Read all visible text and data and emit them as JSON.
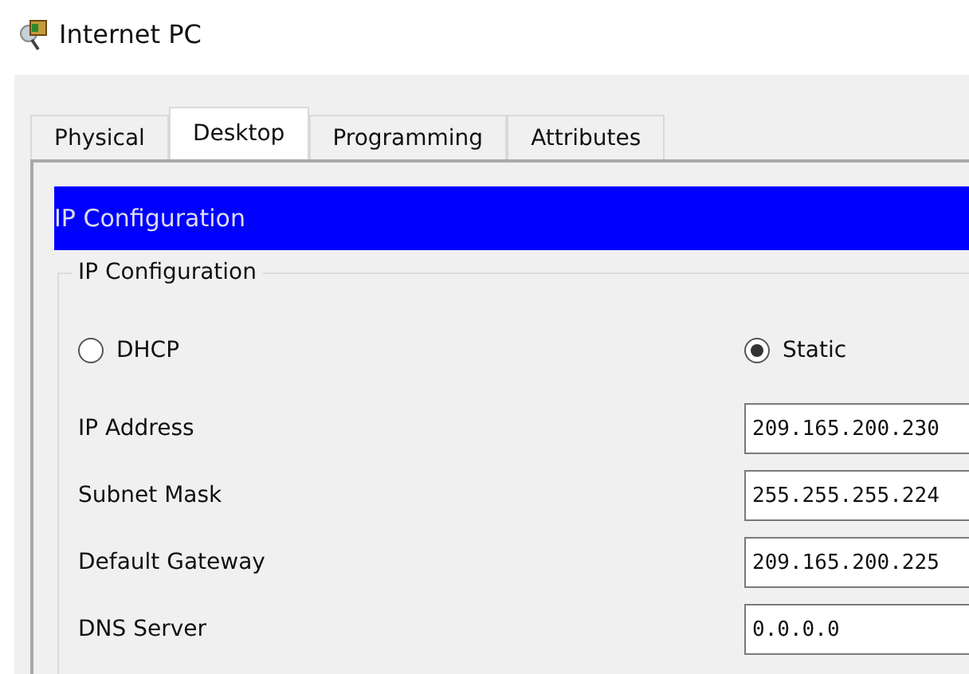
{
  "window": {
    "title": "Internet PC"
  },
  "tabs": [
    {
      "label": "Physical",
      "selected": false
    },
    {
      "label": "Desktop",
      "selected": true
    },
    {
      "label": "Programming",
      "selected": false
    },
    {
      "label": "Attributes",
      "selected": false
    }
  ],
  "header": "IP Configuration",
  "group": {
    "title": "IP Configuration"
  },
  "modes": [
    {
      "label": "DHCP",
      "selected": false
    },
    {
      "label": "Static",
      "selected": true
    }
  ],
  "fields": [
    {
      "label": "IP Address",
      "value": "209.165.200.230"
    },
    {
      "label": "Subnet Mask",
      "value": "255.255.255.224"
    },
    {
      "label": "Default Gateway",
      "value": "209.165.200.225"
    },
    {
      "label": "DNS Server",
      "value": "0.0.0.0"
    }
  ]
}
